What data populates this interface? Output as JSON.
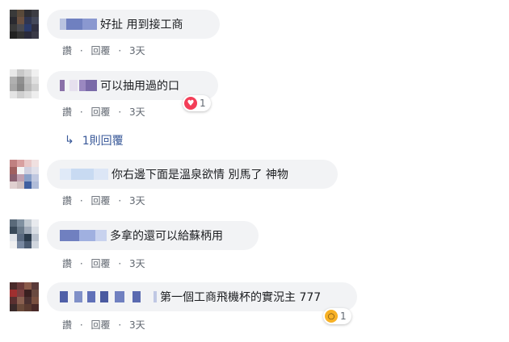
{
  "actions": {
    "like": "讚",
    "reply": "回覆",
    "sep": "·",
    "time": "3天"
  },
  "comments": [
    {
      "text": "好扯 用到接工商"
    },
    {
      "text": "可以抽用過的口",
      "reactions": {
        "icon": "love",
        "count": "1"
      }
    },
    {
      "text": "你右邊下面是溫泉欲情 別馬了 神物"
    },
    {
      "text": "多拿的還可以給蘇柄用"
    },
    {
      "text": "第一個工商飛機杯的實況主 777",
      "reactions": {
        "icon": "wow",
        "count": "1"
      }
    }
  ],
  "reply_thread": {
    "label": "1則回覆"
  },
  "colors": {
    "link": "#385898",
    "meta": "#606770",
    "bubble": "#f2f3f5",
    "love": "#f33e58",
    "wow": "#f7b125"
  }
}
